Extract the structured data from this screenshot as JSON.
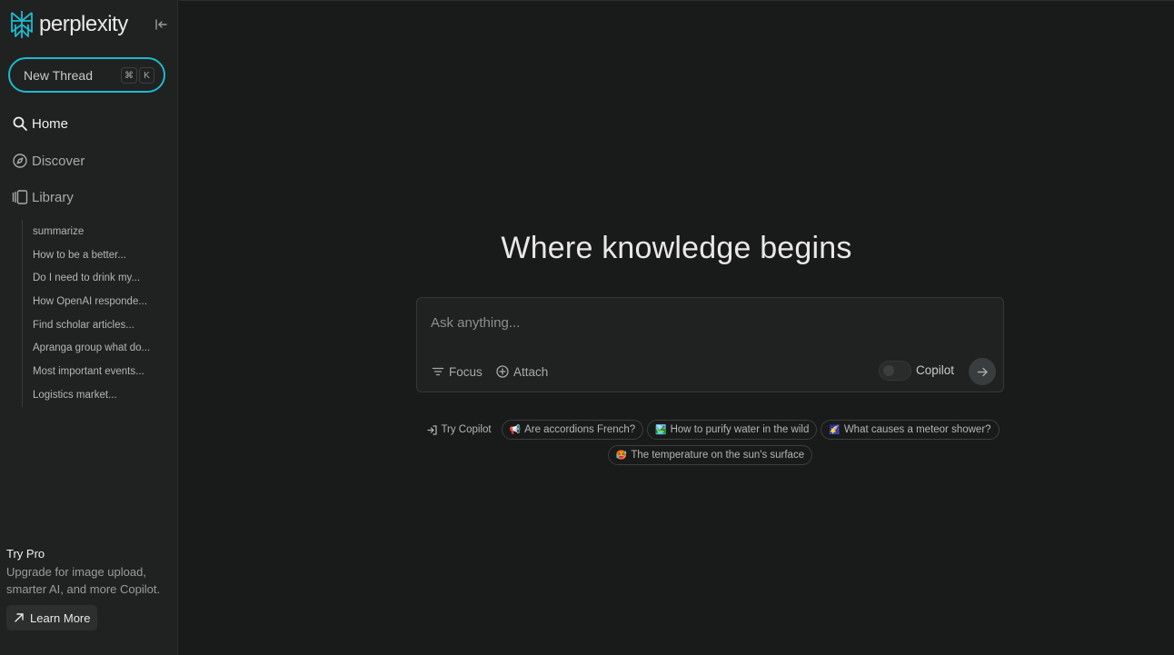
{
  "brand": {
    "name": "perplexity",
    "accent": "#20b8cd"
  },
  "sidebar": {
    "new_thread": {
      "label": "New Thread",
      "shortcut": [
        "⌘",
        "K"
      ]
    },
    "nav": [
      {
        "label": "Home",
        "icon": "search-icon"
      },
      {
        "label": "Discover",
        "icon": "compass-icon"
      },
      {
        "label": "Library",
        "icon": "library-icon"
      }
    ],
    "threads": [
      "summarize",
      "How to be a better...",
      "Do I need to drink my...",
      "How OpenAI responde...",
      "Find scholar articles...",
      "Apranga group what do...",
      "Most important events...",
      "Logistics market..."
    ],
    "pro": {
      "title": "Try Pro",
      "description": "Upgrade for image upload, smarter AI, and more Copilot.",
      "learn_more": "Learn More"
    }
  },
  "main": {
    "headline": "Where knowledge begins",
    "ask": {
      "placeholder": "Ask anything...",
      "focus_label": "Focus",
      "attach_label": "Attach",
      "copilot_label": "Copilot",
      "copilot_on": false
    },
    "suggestions": {
      "try_copilot": "Try Copilot",
      "items": [
        {
          "emoji": "📢",
          "label": "Are accordions French?"
        },
        {
          "emoji": "🏞️",
          "label": "How to purify water in the wild"
        },
        {
          "emoji": "🌠",
          "label": "What causes a meteor shower?"
        },
        {
          "emoji": "🥵",
          "label": "The temperature on the sun's surface"
        }
      ]
    }
  }
}
